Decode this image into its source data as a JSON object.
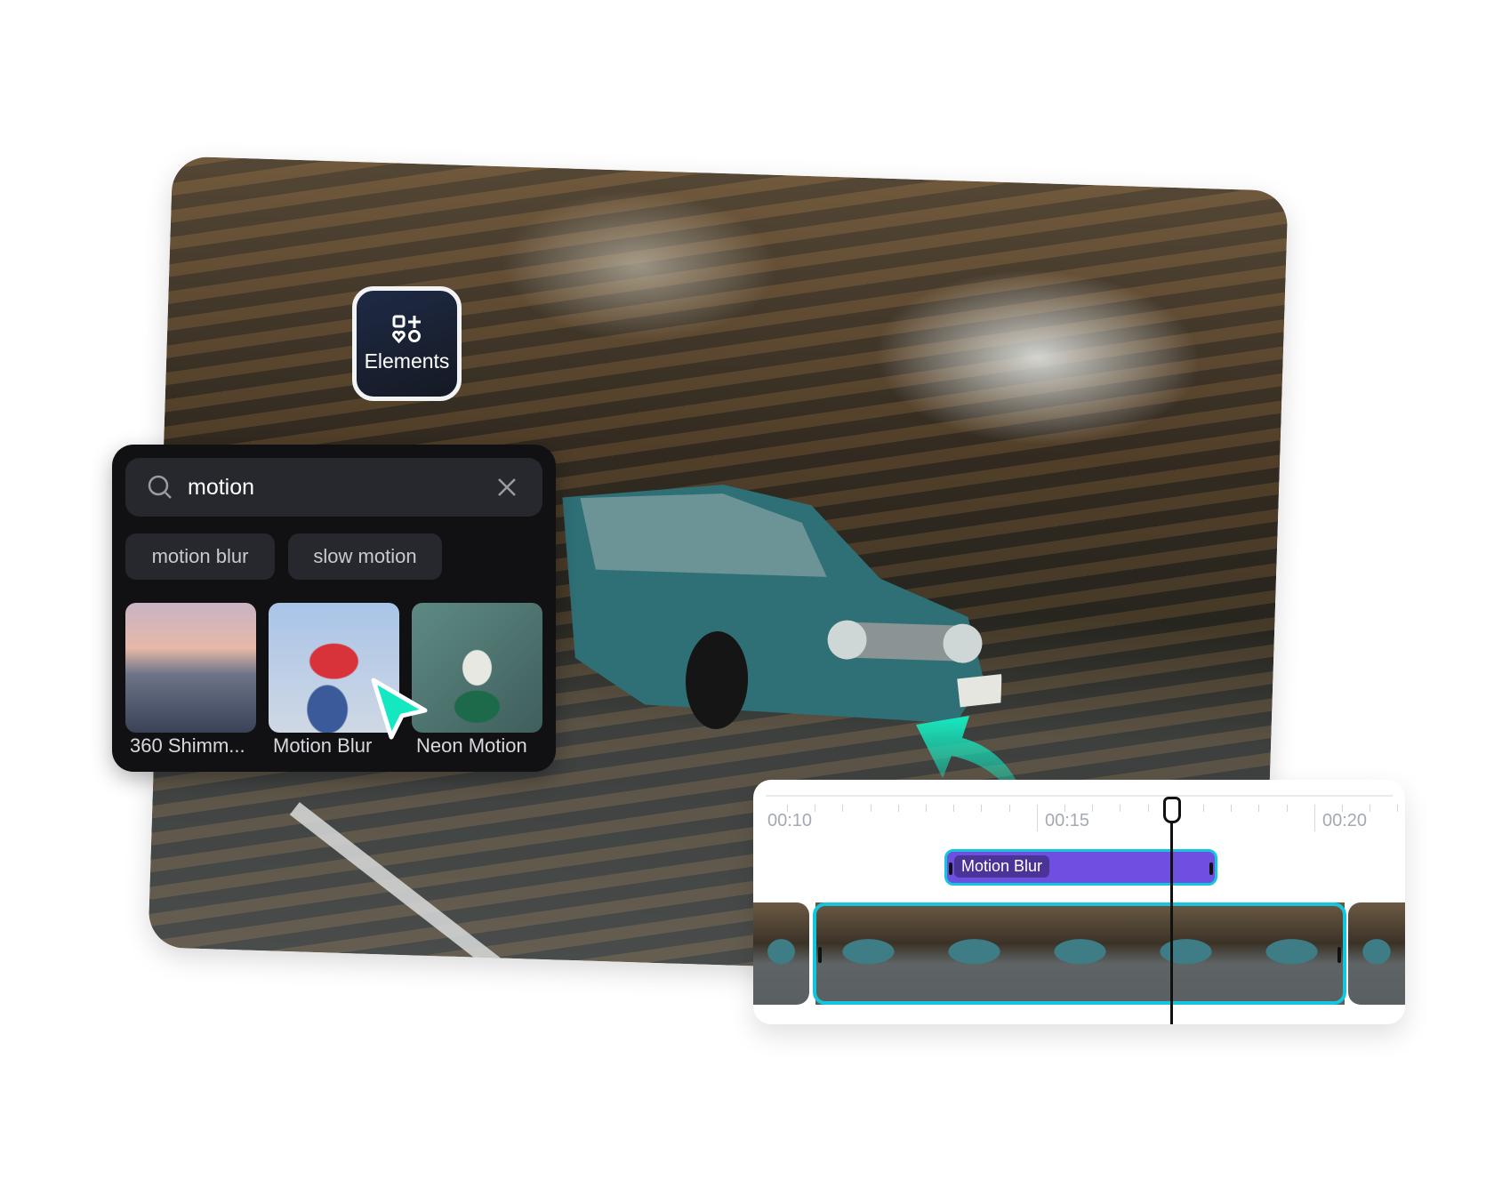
{
  "elements_button": {
    "label": "Elements",
    "icon": "elements-shapes-icon"
  },
  "search": {
    "value": "motion",
    "icons": {
      "search": "search-icon",
      "clear": "close-icon"
    }
  },
  "suggestions": [
    "motion blur",
    "slow motion"
  ],
  "results": [
    {
      "label": "360 Shimm...",
      "colors": [
        "#c9a9b0",
        "#3a4258"
      ]
    },
    {
      "label": "Motion Blur",
      "colors": [
        "#a9c4e8",
        "#d8333a"
      ]
    },
    {
      "label": "Neon Motion",
      "colors": [
        "#5e8a84",
        "#1d6a4a"
      ]
    }
  ],
  "timeline": {
    "time_labels": [
      "00:10",
      "00:15",
      "00:20"
    ],
    "effect_clip": {
      "label": "Motion Blur",
      "color": "#6e4fe0"
    },
    "selection_color": "#13c6dc"
  },
  "cursor_color": "#14e8c0"
}
